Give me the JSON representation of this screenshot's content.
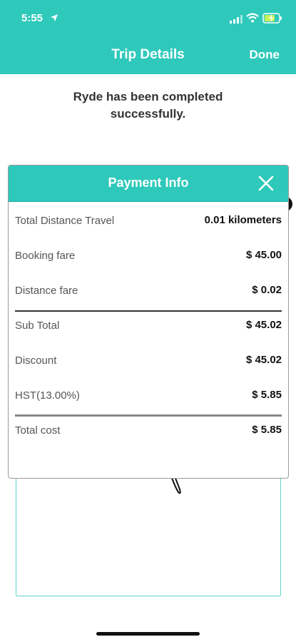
{
  "status_bar": {
    "time": "5:55"
  },
  "nav": {
    "title": "Trip Details",
    "done_label": "Done"
  },
  "message": "Ryde has been completed successfully.",
  "modal": {
    "title": "Payment Info",
    "rows": [
      {
        "label": "Total Distance Travel",
        "value": "0.01 kilometers"
      },
      {
        "label": "Booking fare",
        "value": "$ 45.00"
      },
      {
        "label": "Distance fare",
        "value": "$ 0.02"
      },
      {
        "label": "Sub Total",
        "value": "$ 45.02"
      },
      {
        "label": "Discount",
        "value": "$ 45.02"
      },
      {
        "label": "HST(13.00%)",
        "value": "$ 5.85"
      },
      {
        "label": "Total cost",
        "value": "$ 5.85"
      }
    ]
  },
  "colors": {
    "accent": "#2ec9bb",
    "border": "#5fd6cb"
  },
  "icons": [
    "location-arrow-icon",
    "signal-icon",
    "wifi-icon",
    "battery-charging-icon",
    "close-icon"
  ]
}
